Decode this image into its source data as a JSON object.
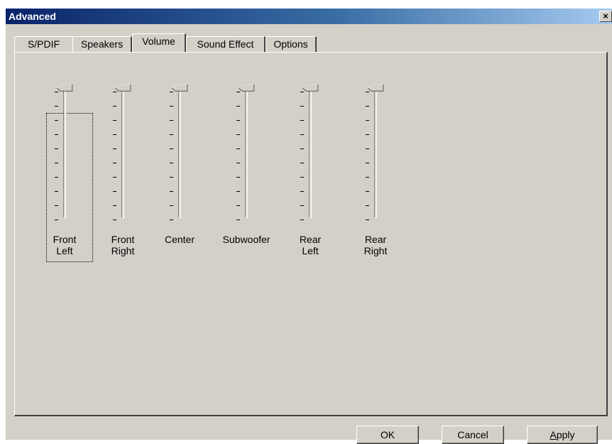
{
  "window": {
    "title": "Advanced",
    "close_symbol": "×"
  },
  "tabs": [
    {
      "label": "S/PDIF",
      "active": false
    },
    {
      "label": "Speakers",
      "active": false
    },
    {
      "label": "Volume",
      "active": true
    },
    {
      "label": "Sound Effect",
      "active": false
    },
    {
      "label": "Options",
      "active": false
    }
  ],
  "sliders": [
    {
      "label": "Front\nLeft",
      "level": 1.0
    },
    {
      "label": "Front\nRight",
      "level": 1.0
    },
    {
      "label": "Center",
      "level": 1.0
    },
    {
      "label": "Subwoofer",
      "level": 1.0
    },
    {
      "label": "Rear\nLeft",
      "level": 1.0
    },
    {
      "label": "Rear\nRight",
      "level": 1.0
    }
  ],
  "buttons": {
    "ok": "OK",
    "cancel": "Cancel",
    "apply": "Apply"
  }
}
